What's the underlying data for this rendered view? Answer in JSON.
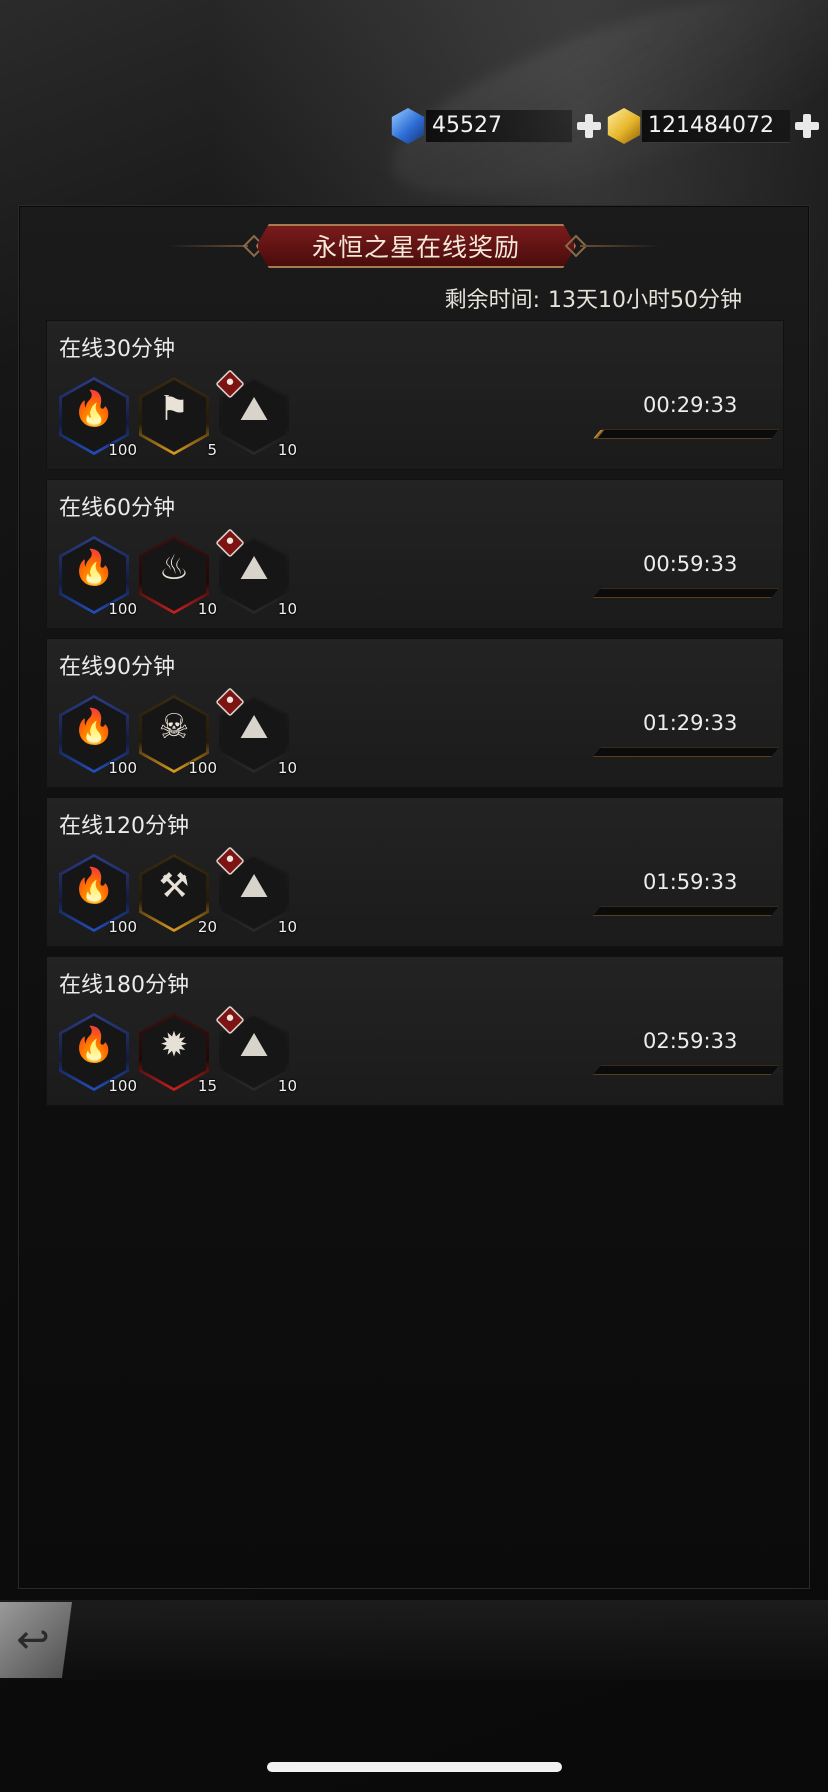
{
  "currency": {
    "gems": {
      "value": "45527",
      "icon": "blue-gem-icon"
    },
    "gold": {
      "value": "121484072",
      "icon": "gold-gem-icon"
    }
  },
  "panel": {
    "title": "永恒之星在线奖励",
    "remaining_label": "剩余时间:",
    "remaining_value": "13天10小时50分钟"
  },
  "rows": [
    {
      "title": "在线30分钟",
      "timer": "00:29:33",
      "progress": 0.02,
      "items": [
        {
          "name": "torch-icon",
          "frame": "blue",
          "count": "100"
        },
        {
          "name": "banner-icon",
          "frame": "gold",
          "count": "5"
        },
        {
          "name": "stones-icon",
          "frame": "dark",
          "count": "10",
          "tag": true
        }
      ]
    },
    {
      "title": "在线60分钟",
      "timer": "00:59:33",
      "progress": 0.0,
      "items": [
        {
          "name": "torch-icon",
          "frame": "blue",
          "count": "100"
        },
        {
          "name": "flame-icon",
          "frame": "red",
          "count": "10"
        },
        {
          "name": "stones-icon",
          "frame": "dark",
          "count": "10",
          "tag": true
        }
      ]
    },
    {
      "title": "在线90分钟",
      "timer": "01:29:33",
      "progress": 0.0,
      "items": [
        {
          "name": "torch-icon",
          "frame": "blue",
          "count": "100"
        },
        {
          "name": "skull-icon",
          "frame": "gold",
          "count": "100"
        },
        {
          "name": "stones-icon",
          "frame": "dark",
          "count": "10",
          "tag": true
        }
      ]
    },
    {
      "title": "在线120分钟",
      "timer": "01:59:33",
      "progress": 0.0,
      "items": [
        {
          "name": "torch-icon",
          "frame": "blue",
          "count": "100"
        },
        {
          "name": "mace-icon",
          "frame": "gold",
          "count": "20"
        },
        {
          "name": "stones-icon",
          "frame": "dark",
          "count": "10",
          "tag": true
        }
      ]
    },
    {
      "title": "在线180分钟",
      "timer": "02:59:33",
      "progress": 0.0,
      "items": [
        {
          "name": "torch-icon",
          "frame": "blue",
          "count": "100"
        },
        {
          "name": "spiked-shell-icon",
          "frame": "red",
          "count": "15"
        },
        {
          "name": "stones-icon",
          "frame": "dark",
          "count": "10",
          "tag": true
        }
      ]
    }
  ],
  "back_button": {
    "icon": "back-arrow-icon"
  }
}
